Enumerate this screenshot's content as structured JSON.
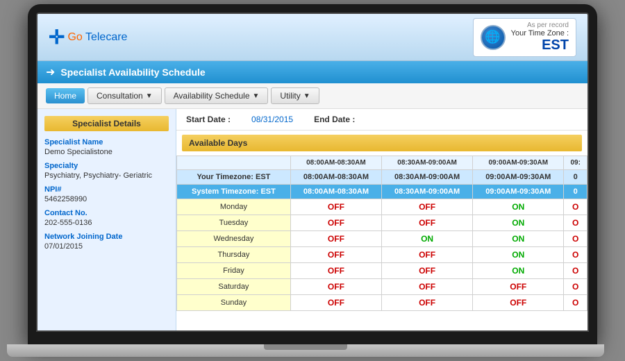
{
  "header": {
    "logo_go": "Go",
    "logo_telecare": "Telecare",
    "as_per_record": "As per record",
    "timezone_label": "Your Time Zone :",
    "timezone_value": "EST"
  },
  "page_title": "Specialist Availability Schedule",
  "nav": {
    "home": "Home",
    "consultation": "Consultation",
    "availability": "Availability Schedule",
    "utility": "Utility"
  },
  "specialist": {
    "panel_title": "Specialist Details",
    "name_label": "Specialist Name",
    "name_value": "Demo Specialistone",
    "specialty_label": "Specialty",
    "specialty_value": "Psychiatry, Psychiatry- Geriatric",
    "npi_label": "NPI#",
    "npi_value": "5462258990",
    "contact_label": "Contact No.",
    "contact_value": "202-555-0136",
    "network_label": "Network Joining Date",
    "network_value": "07/01/2015"
  },
  "schedule": {
    "start_date_label": "Start Date :",
    "start_date_value": "08/31/2015",
    "end_date_label": "End Date :",
    "end_date_value": "",
    "available_days_title": "Available Days",
    "your_tz_label": "Your Timezone: EST",
    "system_tz_label": "System Timezone: EST",
    "columns": [
      "08:00AM-08:30AM",
      "08:30AM-09:00AM",
      "09:00AM-09:30AM",
      "09:"
    ],
    "col_your_tz": [
      "08:00AM-08:30AM",
      "08:30AM-09:00AM",
      "09:00AM-09:30AM"
    ],
    "col_system_tz": [
      "08:00AM-08:30AM",
      "08:30AM-09:00AM",
      "09:00AM-09:30AM"
    ],
    "days": [
      {
        "day": "Monday",
        "slots": [
          "OFF",
          "OFF",
          "ON",
          "O"
        ]
      },
      {
        "day": "Tuesday",
        "slots": [
          "OFF",
          "OFF",
          "ON",
          "O"
        ]
      },
      {
        "day": "Wednesday",
        "slots": [
          "OFF",
          "ON",
          "ON",
          "O"
        ]
      },
      {
        "day": "Thursday",
        "slots": [
          "OFF",
          "OFF",
          "ON",
          "O"
        ]
      },
      {
        "day": "Friday",
        "slots": [
          "OFF",
          "OFF",
          "ON",
          "O"
        ]
      },
      {
        "day": "Saturday",
        "slots": [
          "OFF",
          "OFF",
          "OFF",
          "O"
        ]
      },
      {
        "day": "Sunday",
        "slots": [
          "OFF",
          "OFF",
          "OFF",
          "O"
        ]
      }
    ]
  }
}
